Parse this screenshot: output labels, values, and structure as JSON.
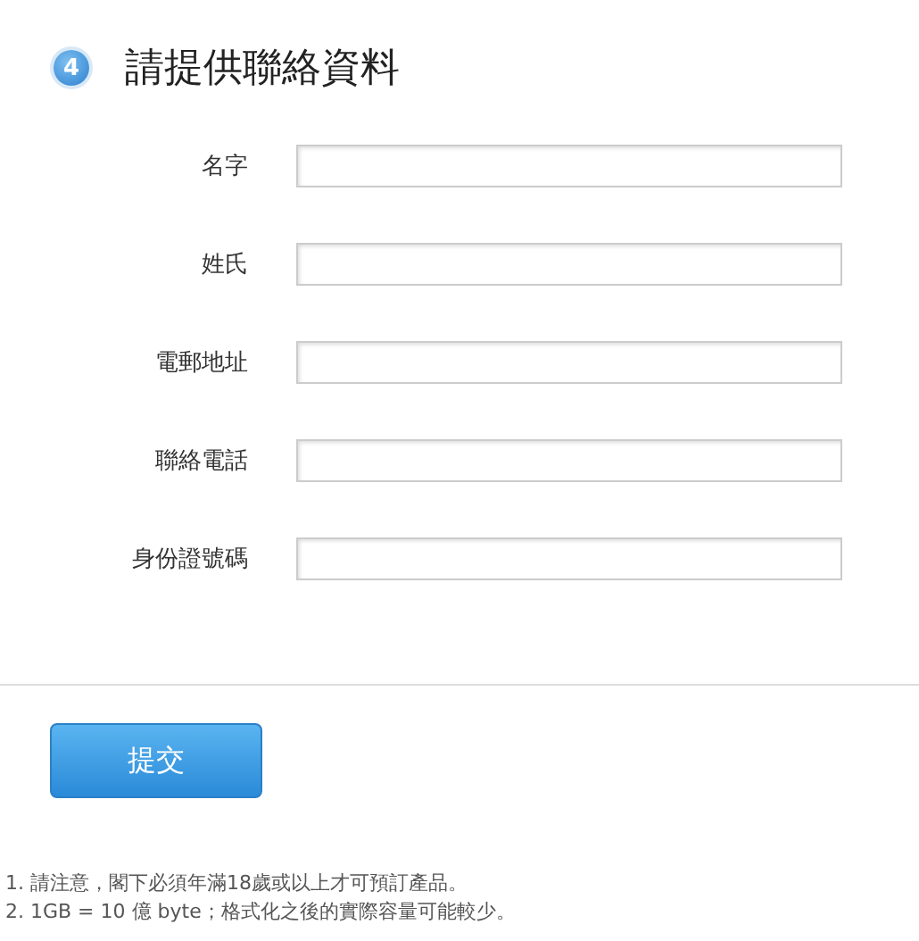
{
  "step": {
    "number": "4",
    "title": "請提供聯絡資料"
  },
  "fields": [
    {
      "label": "名字"
    },
    {
      "label": "姓氏"
    },
    {
      "label": "電郵地址"
    },
    {
      "label": "聯絡電話"
    },
    {
      "label": "身份證號碼"
    }
  ],
  "submit_button": "提交",
  "notes": [
    "1. 請注意，閣下必須年滿18歲或以上才可預訂產品。",
    "2. 1GB = 10 億 byte；格式化之後的實際容量可能較少。"
  ]
}
